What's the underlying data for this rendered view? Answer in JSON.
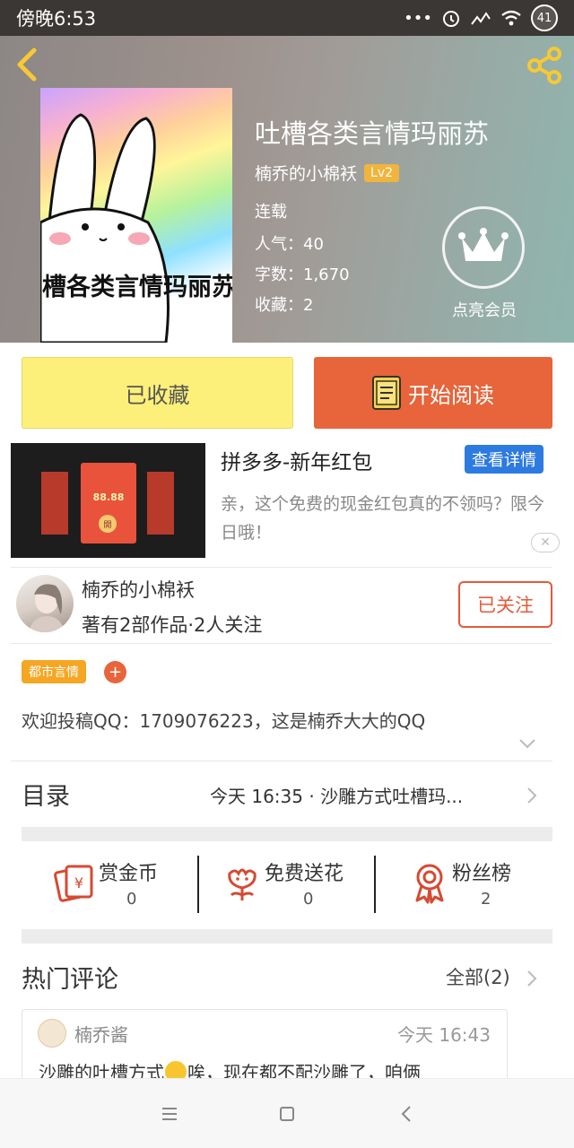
{
  "status_bar": {
    "time": "傍晚6:53",
    "icons": [
      "more-dots-icon",
      "alarm-icon",
      "hd-signal-icon",
      "wifi-icon"
    ],
    "battery": "41"
  },
  "header": {
    "book_title": "吐槽各类言情玛丽苏",
    "author": "楠乔的小棉袄",
    "level": "Lv2",
    "status": "连载",
    "popularity": "人气：40",
    "word_count": "字数：1,670",
    "favorites": "收藏：2",
    "vip_label": "点亮会员",
    "cover_text": "槽各类言情玛丽苏"
  },
  "actions": {
    "collected_label": "已收藏",
    "read_label": "开始阅读"
  },
  "ad": {
    "title": "拼多多-新年红包",
    "detail_label": "查看详情",
    "description": "亲，这个免费的现金红包真的不领吗？限今日哦！",
    "amount": "88.88",
    "open_label": "開"
  },
  "author_card": {
    "name": "楠乔的小棉袄",
    "stats": "著有2部作品·2人关注",
    "follow_label": "已关注"
  },
  "tags": {
    "items": [
      "都市言情"
    ],
    "add_label": "+"
  },
  "intro": "欢迎投稿QQ：1709076223，这是楠乔大大的QQ",
  "toc": {
    "label": "目录",
    "latest": "今天 16:35 · 沙雕方式吐槽玛..."
  },
  "gifts": [
    {
      "label": "赏金币",
      "count": "0",
      "icon": "red-envelope-icon"
    },
    {
      "label": "免费送花",
      "count": "0",
      "icon": "flower-icon"
    },
    {
      "label": "粉丝榜",
      "count": "2",
      "icon": "ribbon-badge-icon"
    }
  ],
  "comments": {
    "title": "热门评论",
    "all_label": "全部(2)",
    "items": [
      {
        "user": "楠乔酱",
        "time": "今天 16:43",
        "text_before": "沙雕的吐槽方式",
        "text_after": "唉，现在都不配沙雕了，咱俩"
      }
    ]
  },
  "colors": {
    "accent_orange": "#e8643a",
    "collected_yellow": "#fcf07a",
    "blue_badge": "#2d7be0",
    "tag_orange": "#f5a623",
    "back_icon_yellow": "#f7c933"
  }
}
